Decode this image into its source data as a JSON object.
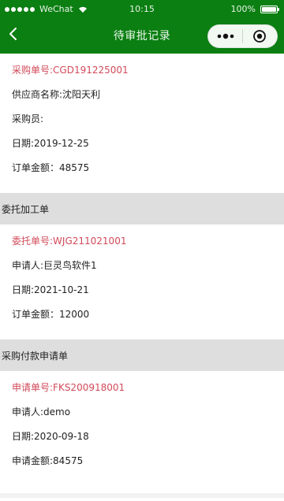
{
  "status_bar": {
    "carrier": "WeChat",
    "time": "10:15",
    "battery_text": "100%",
    "battery_level": 1.0
  },
  "nav": {
    "title": "待审批记录",
    "more_icon": "more-dots-icon",
    "close_icon": "target-close-icon",
    "back_icon": "chevron-left-icon"
  },
  "colors": {
    "header_bg": "#0b7f12",
    "number_text": "#d14a59",
    "section_bg": "#dedede"
  },
  "purchase": {
    "number_label": "采购单号:CGD191225001",
    "supplier": "供应商名称:沈阳天利",
    "buyer": "采购员:",
    "date": "日期:2019-12-25",
    "amount": "订单金额：48575"
  },
  "outsourcing": {
    "section_title": "委托加工单",
    "number_label": "委托单号:WJG211021001",
    "applicant": "申请人:巨灵鸟软件1",
    "date": "日期:2021-10-21",
    "amount": "订单金额：12000"
  },
  "payment": {
    "section_title": "采购付款申请单",
    "number_label": "申请单号:FKS200918001",
    "applicant": "申请人:demo",
    "date": "日期:2020-09-18",
    "amount": "申请金额:84575"
  }
}
